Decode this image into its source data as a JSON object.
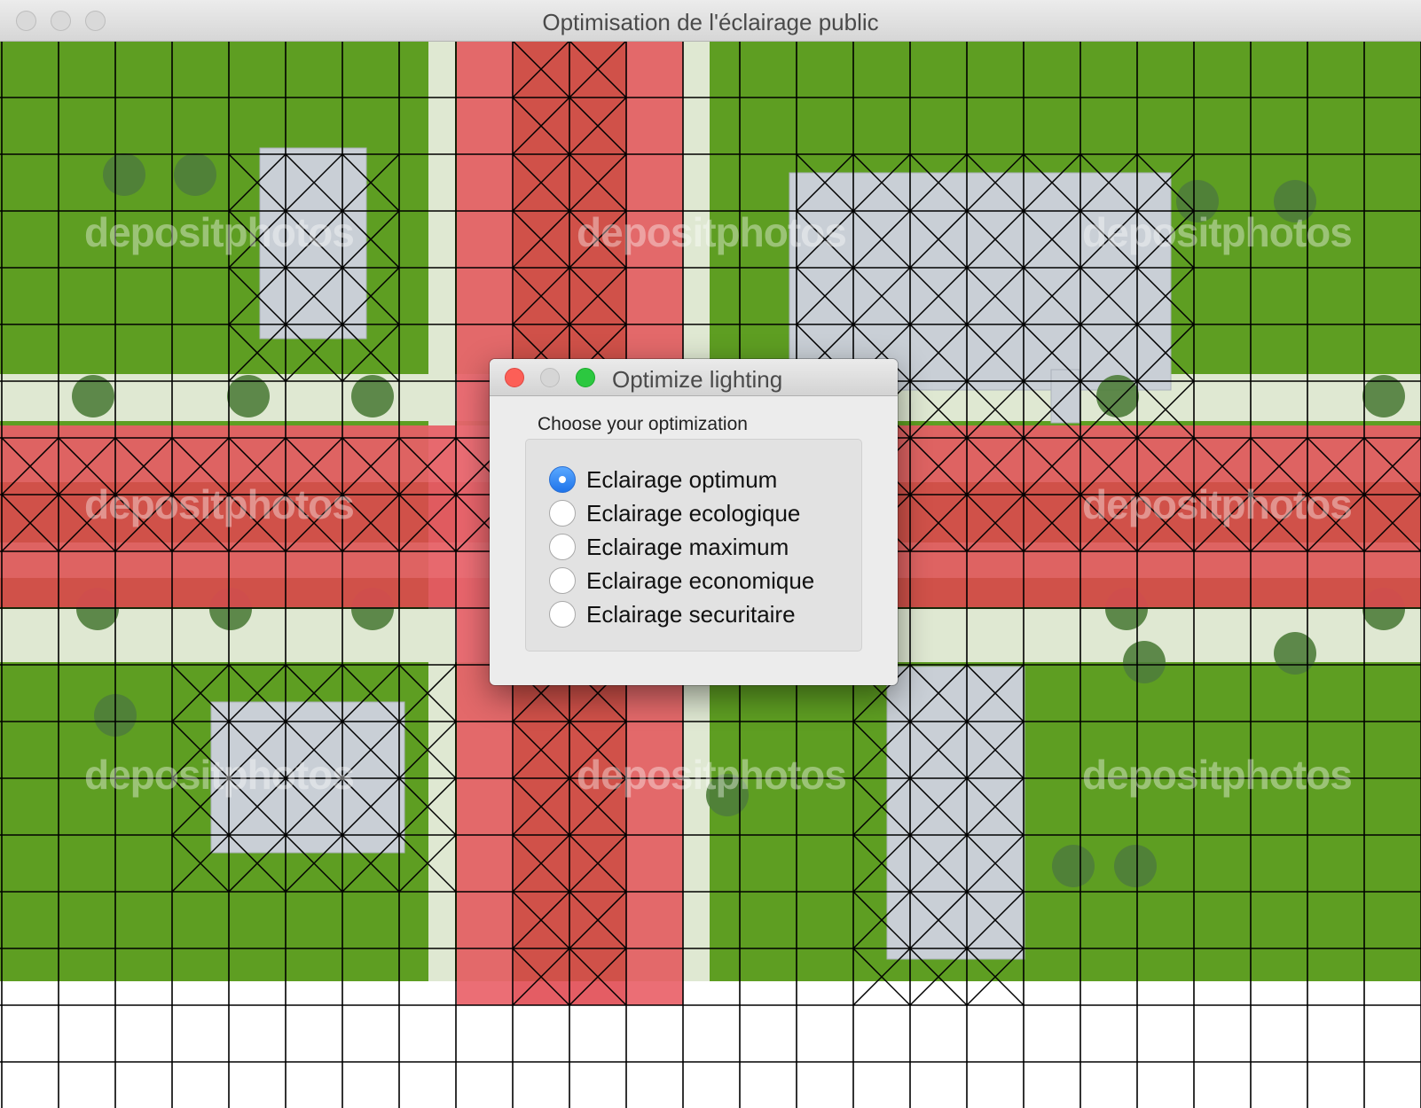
{
  "window": {
    "title": "Optimisation de l'éclairage public"
  },
  "dialog": {
    "title": "Optimize lighting",
    "prompt": "Choose your optimization",
    "options": [
      {
        "label": "Eclairage optimum",
        "selected": true
      },
      {
        "label": "Eclairage ecologique",
        "selected": false
      },
      {
        "label": "Eclairage maximum",
        "selected": false
      },
      {
        "label": "Eclairage economique",
        "selected": false
      },
      {
        "label": "Eclairage securitaire",
        "selected": false
      }
    ]
  },
  "map": {
    "watermark": "depositphotos",
    "colors": {
      "grass": "#5e9e22",
      "sidewalk": "#dfe8d2",
      "road_highlight": "#e0474f",
      "building": "#c9cfd6",
      "grid": "#000000"
    }
  }
}
